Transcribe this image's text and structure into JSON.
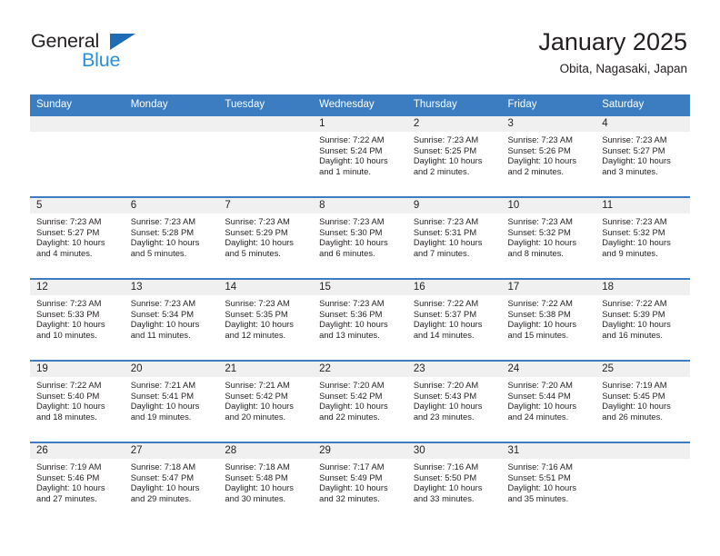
{
  "brand": {
    "name_top": "General",
    "name_bottom": "Blue",
    "accent_dark": "#1d6cb5",
    "accent_light": "#2b8fe0"
  },
  "header": {
    "title": "January 2025",
    "subtitle": "Obita, Nagasaki, Japan"
  },
  "theme": {
    "header_bg": "#3b7dc0",
    "header_text": "#ffffff",
    "daynum_bg": "#f0f0f0",
    "text": "#231f20"
  },
  "weekday_headers": [
    "Sunday",
    "Monday",
    "Tuesday",
    "Wednesday",
    "Thursday",
    "Friday",
    "Saturday"
  ],
  "weeks": [
    [
      {
        "day": "",
        "sunrise": "",
        "sunset": "",
        "daylight": "",
        "empty": true
      },
      {
        "day": "",
        "sunrise": "",
        "sunset": "",
        "daylight": "",
        "empty": true
      },
      {
        "day": "",
        "sunrise": "",
        "sunset": "",
        "daylight": "",
        "empty": true
      },
      {
        "day": "1",
        "sunrise": "Sunrise: 7:22 AM",
        "sunset": "Sunset: 5:24 PM",
        "daylight": "Daylight: 10 hours and 1 minute."
      },
      {
        "day": "2",
        "sunrise": "Sunrise: 7:23 AM",
        "sunset": "Sunset: 5:25 PM",
        "daylight": "Daylight: 10 hours and 2 minutes."
      },
      {
        "day": "3",
        "sunrise": "Sunrise: 7:23 AM",
        "sunset": "Sunset: 5:26 PM",
        "daylight": "Daylight: 10 hours and 2 minutes."
      },
      {
        "day": "4",
        "sunrise": "Sunrise: 7:23 AM",
        "sunset": "Sunset: 5:27 PM",
        "daylight": "Daylight: 10 hours and 3 minutes."
      }
    ],
    [
      {
        "day": "5",
        "sunrise": "Sunrise: 7:23 AM",
        "sunset": "Sunset: 5:27 PM",
        "daylight": "Daylight: 10 hours and 4 minutes."
      },
      {
        "day": "6",
        "sunrise": "Sunrise: 7:23 AM",
        "sunset": "Sunset: 5:28 PM",
        "daylight": "Daylight: 10 hours and 5 minutes."
      },
      {
        "day": "7",
        "sunrise": "Sunrise: 7:23 AM",
        "sunset": "Sunset: 5:29 PM",
        "daylight": "Daylight: 10 hours and 5 minutes."
      },
      {
        "day": "8",
        "sunrise": "Sunrise: 7:23 AM",
        "sunset": "Sunset: 5:30 PM",
        "daylight": "Daylight: 10 hours and 6 minutes."
      },
      {
        "day": "9",
        "sunrise": "Sunrise: 7:23 AM",
        "sunset": "Sunset: 5:31 PM",
        "daylight": "Daylight: 10 hours and 7 minutes."
      },
      {
        "day": "10",
        "sunrise": "Sunrise: 7:23 AM",
        "sunset": "Sunset: 5:32 PM",
        "daylight": "Daylight: 10 hours and 8 minutes."
      },
      {
        "day": "11",
        "sunrise": "Sunrise: 7:23 AM",
        "sunset": "Sunset: 5:32 PM",
        "daylight": "Daylight: 10 hours and 9 minutes."
      }
    ],
    [
      {
        "day": "12",
        "sunrise": "Sunrise: 7:23 AM",
        "sunset": "Sunset: 5:33 PM",
        "daylight": "Daylight: 10 hours and 10 minutes."
      },
      {
        "day": "13",
        "sunrise": "Sunrise: 7:23 AM",
        "sunset": "Sunset: 5:34 PM",
        "daylight": "Daylight: 10 hours and 11 minutes."
      },
      {
        "day": "14",
        "sunrise": "Sunrise: 7:23 AM",
        "sunset": "Sunset: 5:35 PM",
        "daylight": "Daylight: 10 hours and 12 minutes."
      },
      {
        "day": "15",
        "sunrise": "Sunrise: 7:23 AM",
        "sunset": "Sunset: 5:36 PM",
        "daylight": "Daylight: 10 hours and 13 minutes."
      },
      {
        "day": "16",
        "sunrise": "Sunrise: 7:22 AM",
        "sunset": "Sunset: 5:37 PM",
        "daylight": "Daylight: 10 hours and 14 minutes."
      },
      {
        "day": "17",
        "sunrise": "Sunrise: 7:22 AM",
        "sunset": "Sunset: 5:38 PM",
        "daylight": "Daylight: 10 hours and 15 minutes."
      },
      {
        "day": "18",
        "sunrise": "Sunrise: 7:22 AM",
        "sunset": "Sunset: 5:39 PM",
        "daylight": "Daylight: 10 hours and 16 minutes."
      }
    ],
    [
      {
        "day": "19",
        "sunrise": "Sunrise: 7:22 AM",
        "sunset": "Sunset: 5:40 PM",
        "daylight": "Daylight: 10 hours and 18 minutes."
      },
      {
        "day": "20",
        "sunrise": "Sunrise: 7:21 AM",
        "sunset": "Sunset: 5:41 PM",
        "daylight": "Daylight: 10 hours and 19 minutes."
      },
      {
        "day": "21",
        "sunrise": "Sunrise: 7:21 AM",
        "sunset": "Sunset: 5:42 PM",
        "daylight": "Daylight: 10 hours and 20 minutes."
      },
      {
        "day": "22",
        "sunrise": "Sunrise: 7:20 AM",
        "sunset": "Sunset: 5:42 PM",
        "daylight": "Daylight: 10 hours and 22 minutes."
      },
      {
        "day": "23",
        "sunrise": "Sunrise: 7:20 AM",
        "sunset": "Sunset: 5:43 PM",
        "daylight": "Daylight: 10 hours and 23 minutes."
      },
      {
        "day": "24",
        "sunrise": "Sunrise: 7:20 AM",
        "sunset": "Sunset: 5:44 PM",
        "daylight": "Daylight: 10 hours and 24 minutes."
      },
      {
        "day": "25",
        "sunrise": "Sunrise: 7:19 AM",
        "sunset": "Sunset: 5:45 PM",
        "daylight": "Daylight: 10 hours and 26 minutes."
      }
    ],
    [
      {
        "day": "26",
        "sunrise": "Sunrise: 7:19 AM",
        "sunset": "Sunset: 5:46 PM",
        "daylight": "Daylight: 10 hours and 27 minutes."
      },
      {
        "day": "27",
        "sunrise": "Sunrise: 7:18 AM",
        "sunset": "Sunset: 5:47 PM",
        "daylight": "Daylight: 10 hours and 29 minutes."
      },
      {
        "day": "28",
        "sunrise": "Sunrise: 7:18 AM",
        "sunset": "Sunset: 5:48 PM",
        "daylight": "Daylight: 10 hours and 30 minutes."
      },
      {
        "day": "29",
        "sunrise": "Sunrise: 7:17 AM",
        "sunset": "Sunset: 5:49 PM",
        "daylight": "Daylight: 10 hours and 32 minutes."
      },
      {
        "day": "30",
        "sunrise": "Sunrise: 7:16 AM",
        "sunset": "Sunset: 5:50 PM",
        "daylight": "Daylight: 10 hours and 33 minutes."
      },
      {
        "day": "31",
        "sunrise": "Sunrise: 7:16 AM",
        "sunset": "Sunset: 5:51 PM",
        "daylight": "Daylight: 10 hours and 35 minutes."
      },
      {
        "day": "",
        "sunrise": "",
        "sunset": "",
        "daylight": "",
        "empty": true
      }
    ]
  ]
}
